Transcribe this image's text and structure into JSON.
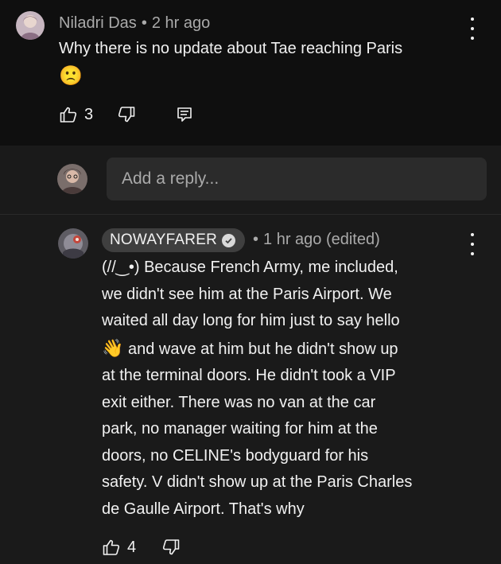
{
  "parent_comment": {
    "author": "Niladri Das",
    "separator": "•",
    "time": "2 hr ago",
    "text": "Why there is no update about Tae reaching Paris",
    "emoji": "🙁",
    "like_count": "3",
    "icons": {
      "avatar": "avatar",
      "more": "more-vert-icon",
      "like": "thumbs-up-icon",
      "dislike": "thumbs-down-icon",
      "reply": "reply-icon"
    }
  },
  "reply_box": {
    "placeholder": "Add a reply..."
  },
  "reply": {
    "author": "NOWAYFARER",
    "verified": true,
    "separator": "•",
    "time": "1 hr ago (edited)",
    "lines": [
      "(//‿•) Because French Army, me included,",
      "we didn't see him at the Paris Airport. We",
      "waited all day long for him just to say hello",
      "and wave at him but he didn't show up",
      "at the terminal doors. He didn't took a VIP",
      "exit either. There was no van at the car",
      "park, no manager waiting for him at the",
      "doors, no CELINE's bodyguard for his",
      "safety. V didn't show up at the Paris Charles",
      "de Gaulle Airport. That's why"
    ],
    "wave_emoji": "👋",
    "like_count": "4"
  },
  "colors": {
    "background": "#0f0f0f",
    "panel": "#1a1a1a",
    "input": "#2b2b2b",
    "chip": "#3f3f3f",
    "text": "#f1f1f1",
    "muted": "#aaaaaa"
  }
}
